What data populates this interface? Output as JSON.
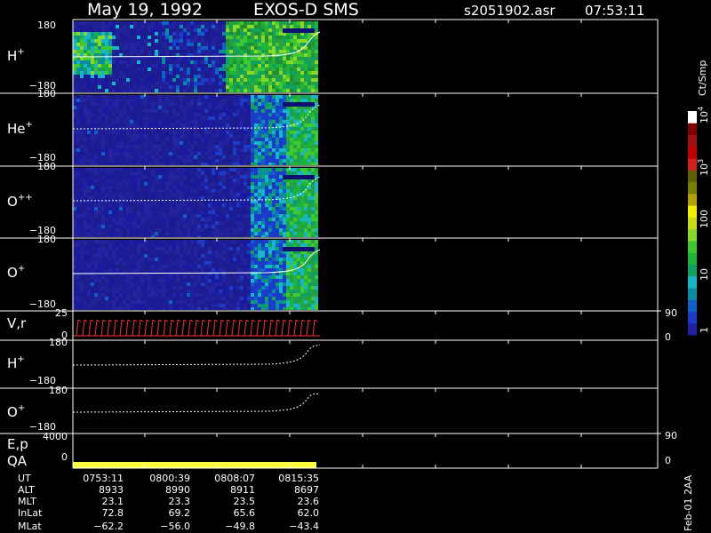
{
  "header": {
    "date": "May 19, 1992",
    "instrument": "EXOS-D SMS",
    "file": "s2051902.asr",
    "time": "07:53:11"
  },
  "colorbar": {
    "unit": "Ct/Smp",
    "ticks": [
      {
        "label": "1",
        "value": 1
      },
      {
        "label": "10",
        "value": 10
      },
      {
        "label": "100",
        "value": 100
      },
      {
        "label": "10",
        "sup": "3",
        "value": 1000
      },
      {
        "label": "10",
        "sup": "4",
        "value": 10000
      }
    ],
    "colors": [
      "#2020a0",
      "#1a3cc8",
      "#1060c8",
      "#0c8ca0",
      "#18b4c8",
      "#10a060",
      "#1eb43c",
      "#40c830",
      "#88d828",
      "#c8dc10",
      "#f0f000",
      "#b4a000",
      "#788000",
      "#606000",
      "#d02020",
      "#c00000",
      "#a01010",
      "#800000",
      "#ffffff"
    ]
  },
  "panels": {
    "h_plus": {
      "label": "H",
      "sup": "+",
      "ymax": "180",
      "ymin": "−180"
    },
    "he_plus": {
      "label": "He",
      "sup": "+",
      "ymax": "180",
      "ymin": "−180"
    },
    "o_plus_plus": {
      "label": "O",
      "sup": "++",
      "ymax": "180",
      "ymin": "−180"
    },
    "o_plus": {
      "label": "O",
      "sup": "+",
      "ymax": "180",
      "ymin": "−180"
    },
    "vr": {
      "label": "V,r",
      "ymax": "25",
      "ymin": "0",
      "right_top": "90",
      "right_bottom": "0"
    },
    "h_plus_line": {
      "label": "H",
      "sup": "+",
      "ymax": "180",
      "ymin": "−180"
    },
    "o_plus_line": {
      "label": "O",
      "sup": "+",
      "ymax": "180",
      "ymin": "−180"
    },
    "ep": {
      "label": "E,p",
      "ymax": "4000",
      "ymin": "0",
      "right_top": "90",
      "right_bottom": "0"
    },
    "qa": {
      "label": "QA"
    }
  },
  "ephemeris": {
    "rows": [
      {
        "name": "UT",
        "values": [
          "0753:11",
          "0800:39",
          "0808:07",
          "0815:35"
        ]
      },
      {
        "name": "ALT",
        "values": [
          "8933",
          "8990",
          "8911",
          "8697"
        ]
      },
      {
        "name": "MLT",
        "values": [
          "23.1",
          "23.3",
          "23.5",
          "23.6"
        ]
      },
      {
        "name": "InLat",
        "values": [
          "72.8",
          "69.2",
          "65.6",
          "62.0"
        ]
      },
      {
        "name": "MLat",
        "values": [
          "−62.2",
          "−56.0",
          "−49.8",
          "−43.4"
        ]
      }
    ]
  },
  "footer_note": "Feb-01 2AA",
  "chart_data": {
    "type": "heatmap",
    "title": "May 19, 1992   EXOS-D SMS",
    "x_axis": "UT",
    "x_ticks": [
      "0753:11",
      "0800:39",
      "0808:07",
      "0815:35"
    ],
    "data_coverage": {
      "start": "0753:11",
      "end": "≈0818:40"
    },
    "spectrograms": [
      {
        "species": "H+",
        "ylim": [
          -180,
          180
        ],
        "dominant_levels": [
          "~1-10 Ct/Smp (blue) 0753-0811",
          "~10-100 Ct/Smp (green) 0811-0818",
          "~100 Ct/Smp (yellow-green) near 0753-0755"
        ]
      },
      {
        "species": "He+",
        "ylim": [
          -180,
          180
        ],
        "dominant_levels": [
          "~1 Ct/Smp (dark blue) 0753-0812",
          "~10-50 Ct/Smp (cyan/green) 0812-0818"
        ]
      },
      {
        "species": "O++",
        "ylim": [
          -180,
          180
        ],
        "dominant_levels": [
          "~1 Ct/Smp (dark blue) 0753-0812",
          "~10-50 Ct/Smp (cyan/green) 0812-0818"
        ]
      },
      {
        "species": "O+",
        "ylim": [
          -180,
          180
        ],
        "dominant_levels": [
          "~1 Ct/Smp (dark blue) 0753-0812",
          "~10-50 Ct/Smp (cyan/green) 0812-0818"
        ]
      }
    ],
    "colorbar_range": [
      1,
      10000
    ],
    "colorbar_scale": "log"
  }
}
